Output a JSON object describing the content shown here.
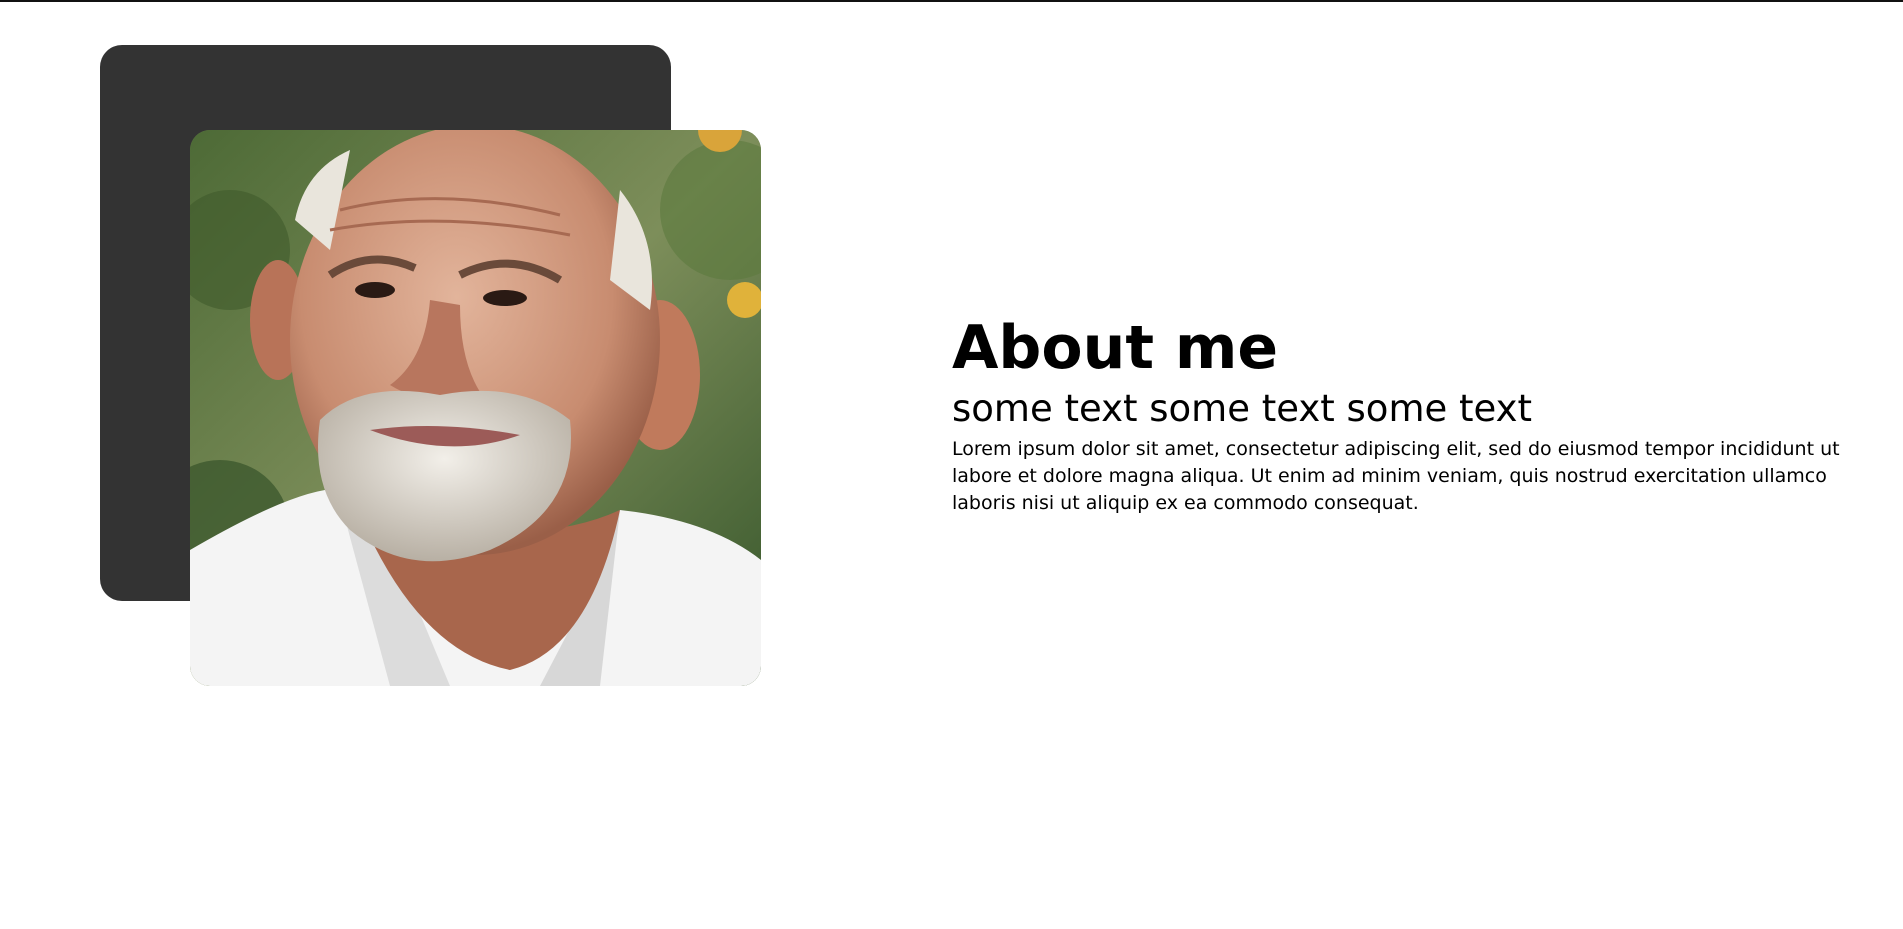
{
  "about": {
    "title": "About me",
    "subtitle": "some text some text some text",
    "body": "Lorem ipsum dolor sit amet, consectetur adipiscing elit, sed do eiusmod tempor incididunt ut labore et dolore magna aliqua. Ut enim ad minim veniam, quis nostrud exercitation ullamco laboris nisi ut aliquip ex ea commodo consequat."
  },
  "colors": {
    "backdrop": "#333333",
    "page_background": "#ffffff",
    "text": "#000000"
  }
}
